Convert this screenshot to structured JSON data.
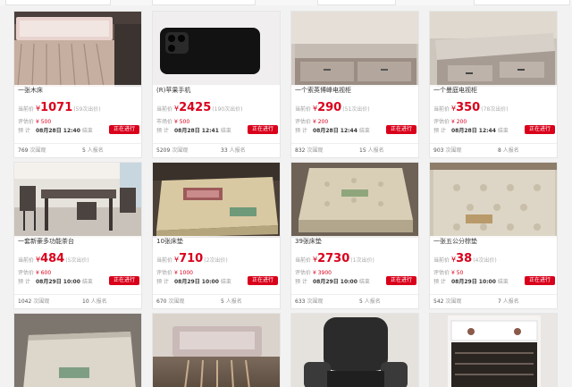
{
  "labels": {
    "current_price": "当前价",
    "valuation": "评估价",
    "market_price": "市场价",
    "estimate": "预  计",
    "end": "结束",
    "views": "次围观",
    "signups": "人报名",
    "bid_suffix": "次出价",
    "yen": "¥"
  },
  "items": [
    {
      "title": "一张木床",
      "price": "1071",
      "bids": "(59次出价)",
      "ref_label": "评估价",
      "ref_price": "¥ 500",
      "end_time": "08月28日 12:40",
      "status": "正在进行",
      "views": "769",
      "signups": "5"
    },
    {
      "title": "(R)苹果手机",
      "price": "2425",
      "bids": "(190次出价)",
      "ref_label": "市场价",
      "ref_price": "¥ 500",
      "end_time": "08月28日 12:41",
      "status": "正在进行",
      "views": "5209",
      "signups": "33"
    },
    {
      "title": "一个索英博峰电视柜",
      "price": "290",
      "bids": "(51次出价)",
      "ref_label": "评估价",
      "ref_price": "¥ 200",
      "end_time": "08月28日 12:44",
      "status": "正在进行",
      "views": "832",
      "signups": "15"
    },
    {
      "title": "一个曼庭电视柜",
      "price": "350",
      "bids": "(78次出价)",
      "ref_label": "评估价",
      "ref_price": "¥ 200",
      "end_time": "08月28日 12:44",
      "status": "正在进行",
      "views": "903",
      "signups": "8"
    },
    {
      "title": "一套新豪多功能茶台",
      "price": "484",
      "bids": "(5次出价)",
      "ref_label": "评估价",
      "ref_price": "¥ 600",
      "end_time": "08月29日 10:00",
      "status": "正在进行",
      "views": "1042",
      "signups": "10"
    },
    {
      "title": "10张床垫",
      "price": "710",
      "bids": "(2次出价)",
      "ref_label": "评估价",
      "ref_price": "¥ 1000",
      "end_time": "08月29日 10:00",
      "status": "正在进行",
      "views": "670",
      "signups": "5"
    },
    {
      "title": "39张床垫",
      "price": "2730",
      "bids": "(1次出价)",
      "ref_label": "评估价",
      "ref_price": "¥ 3900",
      "end_time": "08月29日 10:00",
      "status": "正在进行",
      "views": "633",
      "signups": "5"
    },
    {
      "title": "一张五公分棕垫",
      "price": "38",
      "bids": "(4次出价)",
      "ref_label": "评估价",
      "ref_price": "¥ 50",
      "end_time": "08月29日 10:00",
      "status": "正在进行",
      "views": "542",
      "signups": "7"
    }
  ],
  "partial_items": [
    {
      "image": "mattress-thin"
    },
    {
      "image": "wooden-bed-frame"
    },
    {
      "image": "office-chair"
    },
    {
      "image": "shoe-cabinet"
    }
  ],
  "colors": {
    "accent": "#d9001b",
    "status_bg": "#d9001b"
  }
}
